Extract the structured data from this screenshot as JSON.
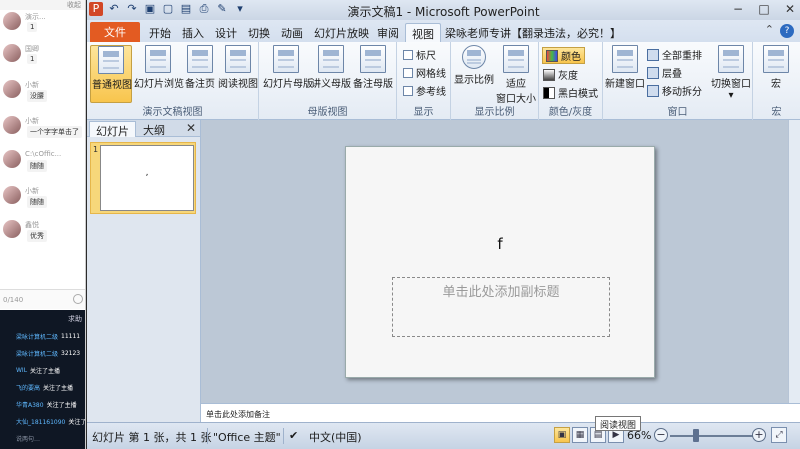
{
  "chat": {
    "top_label": "收起",
    "messages": [
      {
        "name": "演示...",
        "text": "1"
      },
      {
        "name": "国卿",
        "text": "1"
      },
      {
        "name": "小新",
        "text": "没腰"
      },
      {
        "name": "小新",
        "text": "一个字字单击了"
      },
      {
        "name": "C:\\cOffic...",
        "text": "随随"
      },
      {
        "name": "小新",
        "text": "随随"
      },
      {
        "name": "鑫悦",
        "text": "优秀"
      }
    ],
    "input_counter": "0/140"
  },
  "feed": {
    "head": "求助",
    "items": [
      {
        "user": "梁咏计算机二级",
        "text": "11111"
      },
      {
        "user": "梁咏计算机二级",
        "text": "32123"
      },
      {
        "user": "WIL",
        "text": "关注了主播"
      },
      {
        "user": "飞的要高",
        "text": "关注了主播"
      },
      {
        "user": "华青A380",
        "text": "关注了主播"
      },
      {
        "user": "大仙_181161090",
        "text": "关注了"
      },
      {
        "user": "说两句…",
        "text": ""
      }
    ]
  },
  "window": {
    "title": "演示文稿1 - Microsoft PowerPoint",
    "controls": [
      "−",
      "□",
      "✕"
    ]
  },
  "tabs": {
    "file": "文件",
    "items": [
      "开始",
      "插入",
      "设计",
      "切换",
      "动画",
      "幻灯片放映",
      "审阅",
      "视图",
      "梁咏老师专讲【翻录违法，必究！】"
    ],
    "active": "视图"
  },
  "ribbon": {
    "groups": {
      "presentation_views": {
        "label": "演示文稿视图",
        "buttons": [
          "普通视图",
          "幻灯片浏览",
          "备注页",
          "阅读视图"
        ]
      },
      "master_views": {
        "label": "母版视图",
        "buttons": [
          "幻灯片母版",
          "讲义母版",
          "备注母版"
        ]
      },
      "show": {
        "label": "显示",
        "checks": [
          "标尺",
          "网格线",
          "参考线"
        ]
      },
      "zoom": {
        "label": "显示比例",
        "buttons": [
          "显示比例",
          "适应",
          "窗口大小"
        ]
      },
      "color": {
        "label": "颜色/灰度",
        "items": [
          "颜色",
          "灰度",
          "黑白模式"
        ]
      },
      "window": {
        "label": "窗口",
        "new_window": "新建窗口",
        "items": [
          "全部重排",
          "层叠",
          "移动拆分"
        ],
        "switch": "切换窗口"
      },
      "macros": {
        "label": "宏",
        "button": "宏"
      }
    }
  },
  "left_pane": {
    "tabs": [
      "幻灯片",
      "大纲"
    ],
    "close": "✕",
    "thumb_number": "1",
    "thumb_text": ","
  },
  "slide": {
    "title": "f",
    "subtitle_placeholder": "单击此处添加副标题"
  },
  "notes": {
    "placeholder": "单击此处添加备注"
  },
  "status": {
    "slide_info": "幻灯片 第 1 张，共 1 张",
    "theme": "\"Office 主题\"",
    "language": "中文(中国)",
    "zoom": "66%",
    "tooltip": "阅读视图"
  }
}
